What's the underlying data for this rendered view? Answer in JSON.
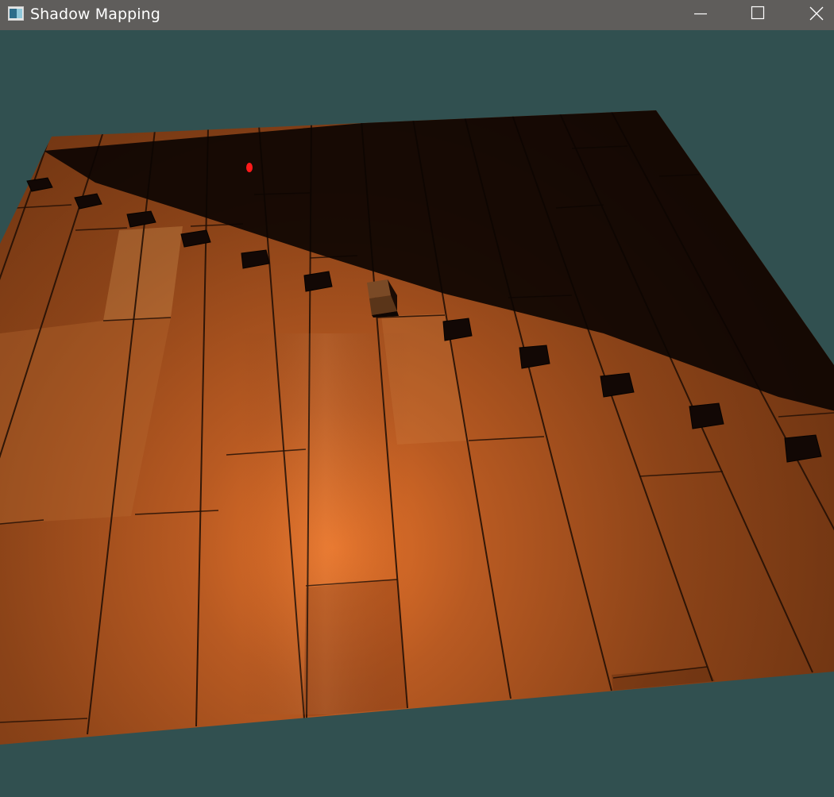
{
  "window": {
    "title": "Shadow Mapping",
    "controls": [
      "minimize",
      "maximize",
      "close"
    ]
  },
  "scene": {
    "clear_color": "#315050",
    "floor_light_color": "#c66a2b",
    "floor_dark_color": "#5a2a0e",
    "shadow_color": "#0b0402",
    "light_source_color": "#ff1a1a",
    "cube_count": 13
  }
}
